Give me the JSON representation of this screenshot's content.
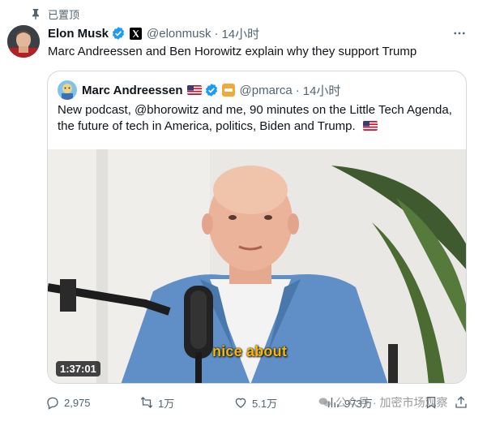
{
  "pinned": {
    "label": "已置顶",
    "icon": "pin-icon"
  },
  "tweet": {
    "author": {
      "name": "Elon Musk",
      "handle": "@elonmusk",
      "verified_icon": "verified-badge-icon",
      "affiliate_icon": "x-logo-icon"
    },
    "separator": "·",
    "time": "14小时",
    "text": "Marc Andreessen and Ben Horowitz explain why they support Trump"
  },
  "quote": {
    "author": {
      "name": "Marc Andreessen",
      "handle": "@pmarca",
      "flag_icon": "us-flag-icon",
      "verified_icon": "verified-badge-icon",
      "org_icon": "a16z-badge-icon"
    },
    "separator": "·",
    "time": "14小时",
    "text": "New podcast, @bhorowitz and me, 90 minutes on the Little Tech Agenda, the future of tech in America, politics, Biden and Trump.",
    "media": {
      "duration": "1:37:01",
      "caption": "nice about"
    }
  },
  "actions": {
    "reply": {
      "count": "2,975",
      "icon": "reply-icon"
    },
    "retweet": {
      "count": "1万",
      "icon": "retweet-icon"
    },
    "like": {
      "count": "5.1万",
      "icon": "heart-icon"
    },
    "views": {
      "count": "973万",
      "icon": "views-chart-icon"
    },
    "bookmark": {
      "icon": "bookmark-icon"
    },
    "share": {
      "icon": "share-icon"
    }
  },
  "watermark": {
    "text": "公众号 · 加密市场观察",
    "icon": "wechat-icon"
  },
  "colors": {
    "text": "#0f1419",
    "secondary": "#536471",
    "border": "#cfd9de",
    "verified": "#1d9bf0",
    "caption": "#f5b700"
  }
}
